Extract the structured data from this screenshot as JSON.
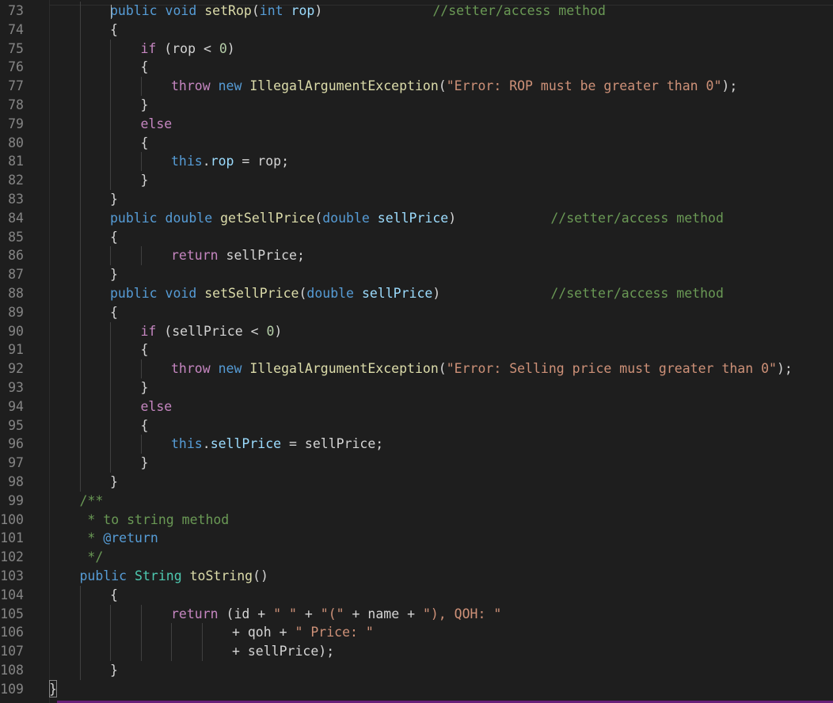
{
  "editor": {
    "line_numbers": [
      "73",
      "74",
      "75",
      "76",
      "77",
      "78",
      "79",
      "80",
      "81",
      "82",
      "83",
      "84",
      "85",
      "86",
      "87",
      "88",
      "89",
      "90",
      "91",
      "92",
      "93",
      "94",
      "95",
      "96",
      "97",
      "98",
      "99",
      "100",
      "101",
      "102",
      "103",
      "104",
      "105",
      "106",
      "107",
      "108",
      "109"
    ],
    "lines": [
      {
        "indent": 2,
        "tokens": [
          [
            "kw",
            "public"
          ],
          [
            "pl",
            " "
          ],
          [
            "kw",
            "void"
          ],
          [
            "pl",
            " "
          ],
          [
            "fn",
            "setRop"
          ],
          [
            "pl",
            "("
          ],
          [
            "kw",
            "int"
          ],
          [
            "pl",
            " "
          ],
          [
            "var",
            "rop"
          ],
          [
            "pl",
            ")"
          ],
          [
            "pl",
            "              "
          ],
          [
            "cm",
            "//setter/access method"
          ]
        ]
      },
      {
        "indent": 2,
        "tokens": [
          [
            "pl",
            "{"
          ]
        ]
      },
      {
        "indent": 3,
        "tokens": [
          [
            "ctl",
            "if"
          ],
          [
            "pl",
            " (rop < "
          ],
          [
            "num",
            "0"
          ],
          [
            "pl",
            ")"
          ]
        ]
      },
      {
        "indent": 3,
        "tokens": [
          [
            "pl",
            "{"
          ]
        ]
      },
      {
        "indent": 4,
        "tokens": [
          [
            "ctl",
            "throw"
          ],
          [
            "pl",
            " "
          ],
          [
            "kw",
            "new"
          ],
          [
            "pl",
            " "
          ],
          [
            "fn",
            "IllegalArgumentException"
          ],
          [
            "pl",
            "("
          ],
          [
            "str",
            "\"Error: ROP must be greater than 0\""
          ],
          [
            "pl",
            ");"
          ]
        ]
      },
      {
        "indent": 3,
        "tokens": [
          [
            "pl",
            "}"
          ]
        ]
      },
      {
        "indent": 3,
        "tokens": [
          [
            "ctl",
            "else"
          ]
        ]
      },
      {
        "indent": 3,
        "tokens": [
          [
            "pl",
            "{"
          ]
        ]
      },
      {
        "indent": 4,
        "tokens": [
          [
            "kw",
            "this"
          ],
          [
            "pl",
            "."
          ],
          [
            "var",
            "rop"
          ],
          [
            "pl",
            " = rop;"
          ]
        ]
      },
      {
        "indent": 3,
        "tokens": [
          [
            "pl",
            "}"
          ]
        ]
      },
      {
        "indent": 2,
        "tokens": [
          [
            "pl",
            "}"
          ]
        ]
      },
      {
        "indent": 2,
        "tokens": [
          [
            "kw",
            "public"
          ],
          [
            "pl",
            " "
          ],
          [
            "kw",
            "double"
          ],
          [
            "pl",
            " "
          ],
          [
            "fn",
            "getSellPrice"
          ],
          [
            "pl",
            "("
          ],
          [
            "kw",
            "double"
          ],
          [
            "pl",
            " "
          ],
          [
            "var",
            "sellPrice"
          ],
          [
            "pl",
            ")"
          ],
          [
            "pl",
            "            "
          ],
          [
            "cm",
            "//setter/access method"
          ]
        ]
      },
      {
        "indent": 2,
        "tokens": [
          [
            "pl",
            "{"
          ]
        ]
      },
      {
        "indent": 4,
        "tokens": [
          [
            "ctl",
            "return"
          ],
          [
            "pl",
            " sellPrice;"
          ]
        ]
      },
      {
        "indent": 2,
        "tokens": [
          [
            "pl",
            "}"
          ]
        ]
      },
      {
        "indent": 2,
        "tokens": [
          [
            "kw",
            "public"
          ],
          [
            "pl",
            " "
          ],
          [
            "kw",
            "void"
          ],
          [
            "pl",
            " "
          ],
          [
            "fn",
            "setSellPrice"
          ],
          [
            "pl",
            "("
          ],
          [
            "kw",
            "double"
          ],
          [
            "pl",
            " "
          ],
          [
            "var",
            "sellPrice"
          ],
          [
            "pl",
            ")"
          ],
          [
            "pl",
            "              "
          ],
          [
            "cm",
            "//setter/access method"
          ]
        ]
      },
      {
        "indent": 2,
        "tokens": [
          [
            "pl",
            "{"
          ]
        ]
      },
      {
        "indent": 3,
        "tokens": [
          [
            "ctl",
            "if"
          ],
          [
            "pl",
            " (sellPrice < "
          ],
          [
            "num",
            "0"
          ],
          [
            "pl",
            ")"
          ]
        ]
      },
      {
        "indent": 3,
        "tokens": [
          [
            "pl",
            "{"
          ]
        ]
      },
      {
        "indent": 4,
        "tokens": [
          [
            "ctl",
            "throw"
          ],
          [
            "pl",
            " "
          ],
          [
            "kw",
            "new"
          ],
          [
            "pl",
            " "
          ],
          [
            "fn",
            "IllegalArgumentException"
          ],
          [
            "pl",
            "("
          ],
          [
            "str",
            "\"Error: Selling price must greater than 0\""
          ],
          [
            "pl",
            ");"
          ]
        ]
      },
      {
        "indent": 3,
        "tokens": [
          [
            "pl",
            "}"
          ]
        ]
      },
      {
        "indent": 3,
        "tokens": [
          [
            "ctl",
            "else"
          ]
        ]
      },
      {
        "indent": 3,
        "tokens": [
          [
            "pl",
            "{"
          ]
        ]
      },
      {
        "indent": 4,
        "tokens": [
          [
            "kw",
            "this"
          ],
          [
            "pl",
            "."
          ],
          [
            "var",
            "sellPrice"
          ],
          [
            "pl",
            " = sellPrice;"
          ]
        ]
      },
      {
        "indent": 3,
        "tokens": [
          [
            "pl",
            "}"
          ]
        ]
      },
      {
        "indent": 2,
        "tokens": [
          [
            "pl",
            "}"
          ]
        ]
      },
      {
        "indent": 1,
        "tokens": [
          [
            "cm",
            "/**"
          ]
        ]
      },
      {
        "indent": 1,
        "tokens": [
          [
            "cm",
            " * to string method"
          ]
        ]
      },
      {
        "indent": 1,
        "tokens": [
          [
            "cm",
            " * "
          ],
          [
            "tag",
            "@return"
          ]
        ]
      },
      {
        "indent": 1,
        "tokens": [
          [
            "cm",
            " */"
          ]
        ]
      },
      {
        "indent": 1,
        "tokens": [
          [
            "kw",
            "public"
          ],
          [
            "pl",
            " "
          ],
          [
            "ty",
            "String"
          ],
          [
            "pl",
            " "
          ],
          [
            "fn",
            "toString"
          ],
          [
            "pl",
            "()"
          ]
        ]
      },
      {
        "indent": 2,
        "tokens": [
          [
            "pl",
            "{"
          ]
        ]
      },
      {
        "indent": 4,
        "tokens": [
          [
            "ctl",
            "return"
          ],
          [
            "pl",
            " (id + "
          ],
          [
            "str",
            "\" \""
          ],
          [
            "pl",
            " + "
          ],
          [
            "str",
            "\"(\""
          ],
          [
            "pl",
            " + name + "
          ],
          [
            "str",
            "\"), QOH: \""
          ]
        ]
      },
      {
        "indent": 6,
        "tokens": [
          [
            "pl",
            "+ qoh + "
          ],
          [
            "str",
            "\" Price: \""
          ]
        ]
      },
      {
        "indent": 6,
        "tokens": [
          [
            "pl",
            "+ sellPrice);"
          ]
        ]
      },
      {
        "indent": 2,
        "tokens": [
          [
            "pl",
            "}"
          ]
        ]
      },
      {
        "indent": 0,
        "tokens": [
          [
            "pl",
            "}"
          ]
        ]
      }
    ]
  }
}
